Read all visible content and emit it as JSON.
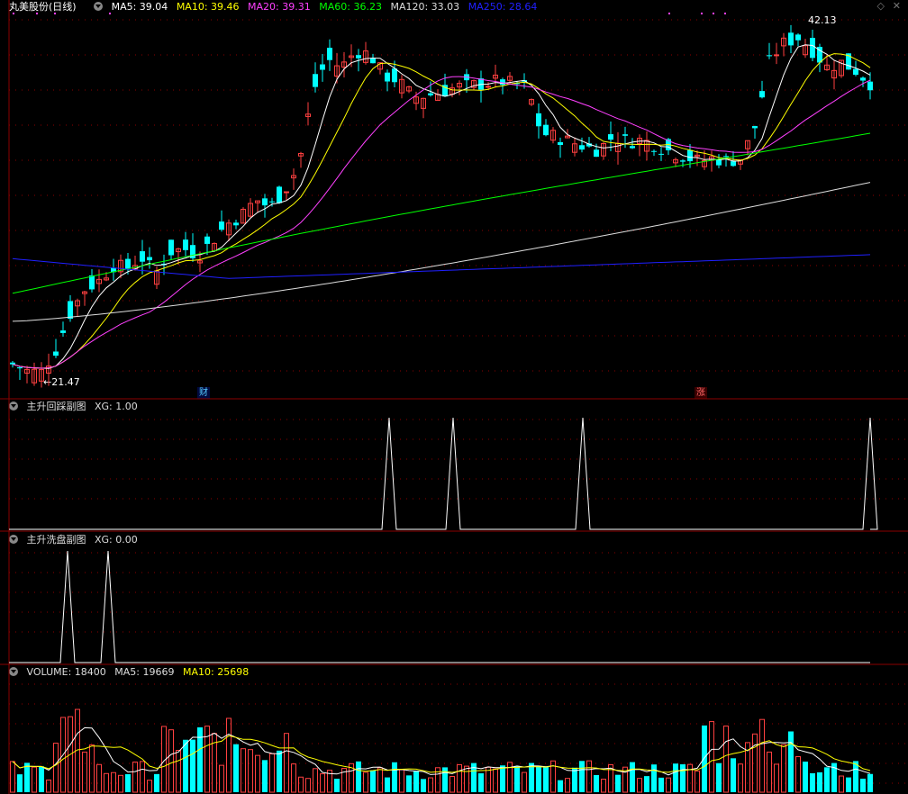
{
  "stock": {
    "name": "丸美股份(日线)"
  },
  "colors": {
    "bg": "#000000",
    "up": "#ff4040",
    "down": "#00ffff",
    "ma5": "#ffffff",
    "ma10": "#ffff00",
    "ma20": "#ff40ff",
    "ma60": "#00ff00",
    "ma120": "#dddddd",
    "ma250": "#2020ff",
    "grid": "#8b0000"
  },
  "main": {
    "indicators": [
      {
        "key": "ma5",
        "label": "MA5: 39.04"
      },
      {
        "key": "ma10",
        "label": "MA10: 39.46"
      },
      {
        "key": "ma20",
        "label": "MA20: 39.31"
      },
      {
        "key": "ma60",
        "label": "MA60: 36.23"
      },
      {
        "key": "ma120",
        "label": "MA120: 33.03"
      },
      {
        "key": "ma250",
        "label": "MA250: 28.64"
      }
    ],
    "high_label": "42.13",
    "low_label": "←21.47",
    "tag_cai": "财",
    "tag_zhang": "涨"
  },
  "sub1": {
    "title": "主升回踩副图",
    "value": "XG: 1.00"
  },
  "sub2": {
    "title": "主升洗盘副图",
    "value": "XG: 0.00"
  },
  "vol": {
    "title": "VOLUME: 18400",
    "ma5": "MA5: 19669",
    "ma10": "MA10: 25698"
  },
  "chart_data": {
    "type": "line",
    "title": "丸美股份(日线)",
    "y_visible_range": [
      20.5,
      43.0
    ],
    "low": 21.47,
    "high": 42.13,
    "ma_series": [
      {
        "name": "MA5",
        "last": 39.04
      },
      {
        "name": "MA10",
        "last": 39.46
      },
      {
        "name": "MA20",
        "last": 39.31
      },
      {
        "name": "MA60",
        "last": 36.23
      },
      {
        "name": "MA120",
        "last": 33.03
      },
      {
        "name": "MA250",
        "last": 28.64
      }
    ],
    "close_path": [
      22,
      21.6,
      21.5,
      22.8,
      25,
      26.5,
      27,
      28,
      27.8,
      28.5,
      27.5,
      28.8,
      29,
      28.6,
      29.5,
      30.5,
      31,
      32,
      31.5,
      32.5,
      34,
      38.5,
      40.5,
      40,
      41,
      40.8,
      39.5,
      39.2,
      38.2,
      38.3,
      38.5,
      38.8,
      38.9,
      39,
      39.2,
      39,
      38.8,
      36,
      35.8,
      35.5,
      35.2,
      35,
      35.8,
      35.5,
      35.6,
      35.3,
      34.9,
      34.6,
      34.3,
      34.5,
      34.3,
      34.5,
      36.5,
      40.5,
      41.5,
      41.8,
      41,
      40,
      40.3,
      39.8,
      39.04
    ],
    "sub1_xg_peaks_x": [
      432,
      503,
      647,
      966
    ],
    "sub2_xg_peaks_x": [
      75,
      120
    ],
    "volume_last": 18400,
    "volume_ma5_last": 19669,
    "volume_ma10_last": 25698
  }
}
